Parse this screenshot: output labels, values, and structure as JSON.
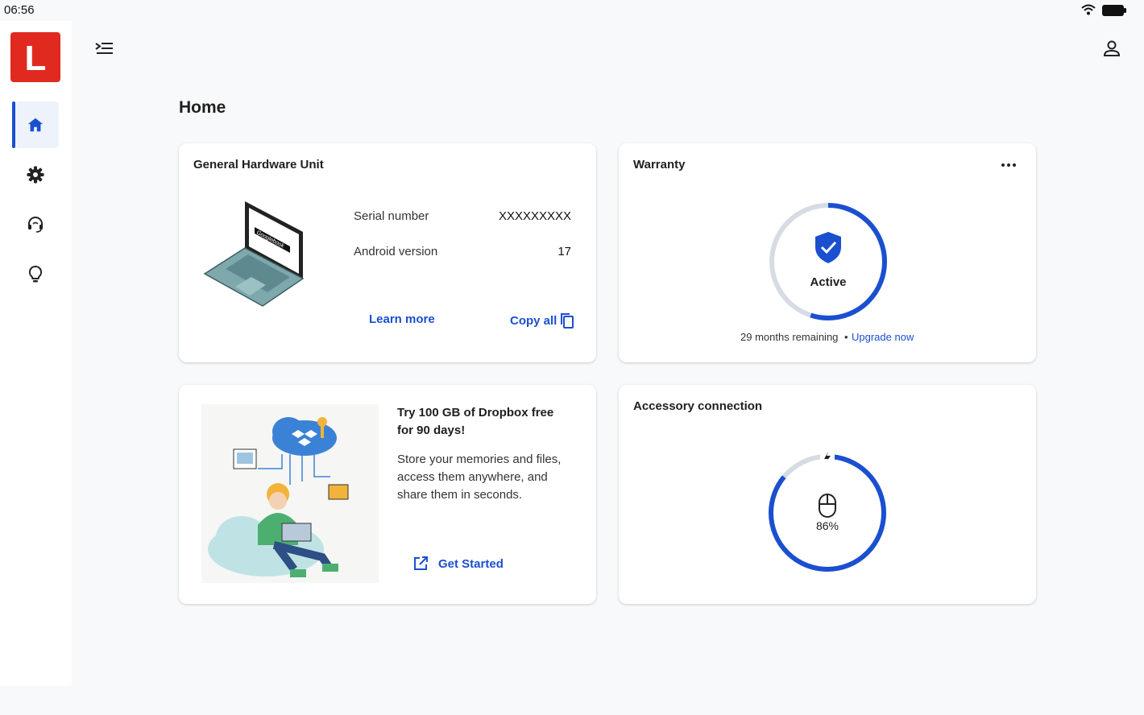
{
  "status_bar": {
    "time": "06:56",
    "wifi_icon": "wifi-icon",
    "battery_icon": "battery-icon"
  },
  "app": {
    "logo_letter": "L",
    "brand_color": "#e02a1f",
    "accent_color": "#1a4fd0"
  },
  "nav_rail": {
    "items": [
      {
        "icon": "home-icon",
        "active": true
      },
      {
        "icon": "gear-icon",
        "active": false
      },
      {
        "icon": "support-headset-icon",
        "active": false
      },
      {
        "icon": "lightbulb-icon",
        "active": false
      }
    ]
  },
  "header": {
    "menu_icon": "menu-collapse-icon",
    "account_icon": "account-icon"
  },
  "page": {
    "title": "Home"
  },
  "hardware_card": {
    "title": "General Hardware Unit",
    "serial_label": "Serial number",
    "serial_value": "XXXXXXXXX",
    "android_label": "Android version",
    "android_value": "17",
    "learn_more": "Learn more",
    "copy_all": "Copy all",
    "laptop_screen_text": "Googlebook"
  },
  "warranty_card": {
    "title": "Warranty",
    "status": "Active",
    "ring_fraction": 0.55,
    "remaining": "29 months remaining",
    "separator": "•",
    "upgrade": "Upgrade now"
  },
  "dropbox_card": {
    "title": "Try 100 GB of Dropbox free for 90 days!",
    "body": "Store your memories and files, access them anywhere, and share them in seconds.",
    "cta": "Get Started"
  },
  "accessory_card": {
    "title": "Accessory connection",
    "battery_percent": "86%",
    "ring_fraction": 0.86
  }
}
